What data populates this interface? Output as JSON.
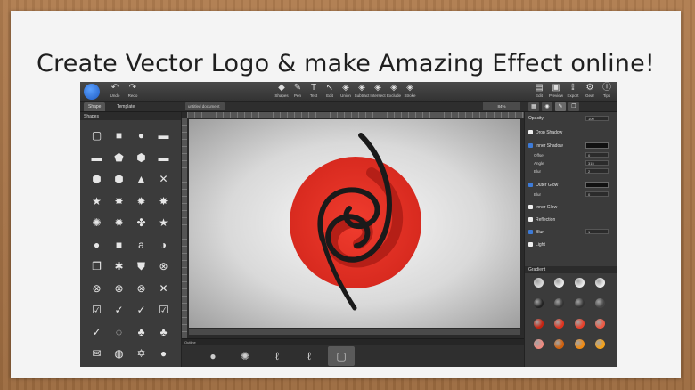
{
  "headline": "Create Vector Logo & make Amazing Effect online!",
  "toolbar_left": [
    {
      "label": "Undo",
      "icon": "undo-icon",
      "glyph": "↶"
    },
    {
      "label": "Redo",
      "icon": "redo-icon",
      "glyph": "↷"
    }
  ],
  "toolbar_center": [
    {
      "label": "Shapes",
      "icon": "shapes-icon",
      "glyph": "◆"
    },
    {
      "label": "Pen",
      "icon": "pen-icon",
      "glyph": "✎"
    },
    {
      "label": "Text",
      "icon": "text-icon",
      "glyph": "T"
    },
    {
      "label": "Edit",
      "icon": "edit-icon",
      "glyph": "↖"
    },
    {
      "label": "Union",
      "icon": "union-icon",
      "glyph": "◈"
    },
    {
      "label": "Subtract",
      "icon": "subtract-icon",
      "glyph": "◈"
    },
    {
      "label": "Intersect",
      "icon": "intersect-icon",
      "glyph": "◈"
    },
    {
      "label": "Exclude",
      "icon": "exclude-icon",
      "glyph": "◈"
    },
    {
      "label": "Stroke",
      "icon": "stroke-icon",
      "glyph": "◈"
    }
  ],
  "toolbar_right": [
    {
      "label": "Edit",
      "icon": "edit-doc-icon",
      "glyph": "▤"
    },
    {
      "label": "Preview",
      "icon": "preview-icon",
      "glyph": "▣"
    },
    {
      "label": "Export",
      "icon": "export-icon",
      "glyph": "⇪"
    },
    {
      "label": "Gear",
      "icon": "gear-icon",
      "glyph": "⚙"
    },
    {
      "label": "Tips",
      "icon": "info-icon",
      "glyph": "ⓘ"
    }
  ],
  "tabs": {
    "shape": "Shape",
    "template": "Template"
  },
  "document_name": "untitled document",
  "zoom": "84%",
  "shapes_panel": {
    "title": "Shapes",
    "items": [
      "▢",
      "■",
      "●",
      "▬",
      "▬",
      "⬟",
      "⬢",
      "▬",
      "⬢",
      "⬢",
      "▲",
      "✕",
      "★",
      "✸",
      "✹",
      "✸",
      "✺",
      "✹",
      "✤",
      "★",
      "●",
      "■",
      "a",
      "◑",
      "❐",
      "✱",
      "⛊",
      "⊗",
      "⊗",
      "⊗",
      "⊗",
      "✕",
      "☑",
      "✓",
      "✓",
      "☑",
      "✓",
      "◌",
      "♣",
      "♣",
      "✉",
      "◍",
      "✡",
      "●"
    ]
  },
  "effects_panel": {
    "opacity_label": "Opacity",
    "opacity_value": "100",
    "drop_shadow": "Drop Shadow",
    "inner_shadow": "Inner Shadow",
    "offset_label": "Offset",
    "offset_value": "0",
    "angle_label": "Angle",
    "angle_value": "315",
    "blur_label": "Blur",
    "blur_value_1": "2",
    "outer_glow": "Outer Glow",
    "blur_value_2": "0",
    "inner_glow": "Inner Glow",
    "reflection": "Reflection",
    "blur_main": "Blur",
    "blur_main_value": "1",
    "light": "Light",
    "gradient_title": "Gradient"
  },
  "bottom_strip": {
    "title": "Outline",
    "items": [
      "●",
      "✺",
      "ℓ",
      "ℓ",
      "▢"
    ]
  },
  "colors": {
    "logo_red": "#e8352a",
    "logo_dark": "#1a1a1a",
    "accent_blue": "#3d7bd8",
    "gradient_swatches": [
      "#d9d9d9",
      "#e9e9e9",
      "#e9e9e9",
      "#e9e9e9",
      "#222222",
      "#333333",
      "#333333",
      "#444444",
      "#c62210",
      "#e0321d",
      "#e8402a",
      "#ef5a44",
      "#ee8a80",
      "#d0600c",
      "#f08a12",
      "#f5a21a"
    ]
  }
}
